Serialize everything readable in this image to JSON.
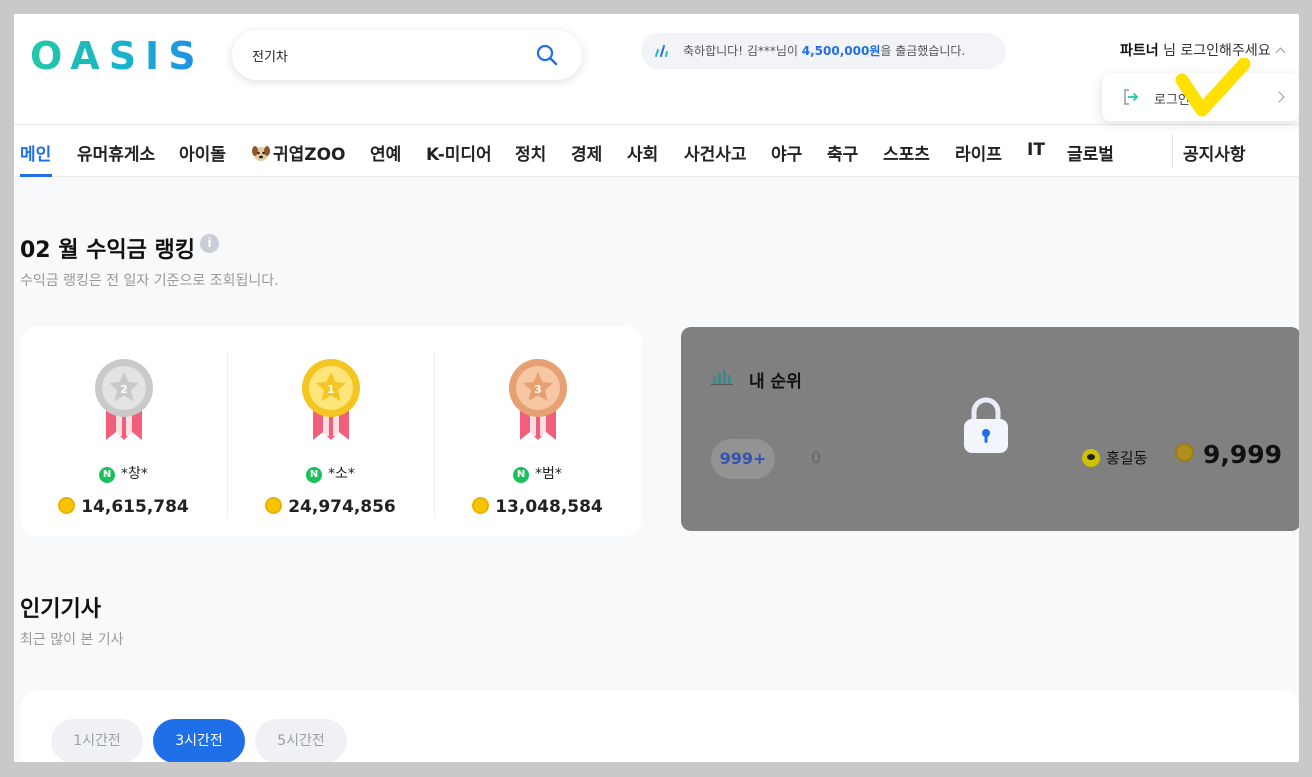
{
  "header": {
    "logo": "OASIS",
    "search_value": "전기차",
    "ticker": {
      "prefix": "축하합니다! 김***님이 ",
      "amount": "4,500,000원",
      "suffix": "을 출금했습니다."
    },
    "user": {
      "partner": "파트너",
      "text": " 님 로그인해주세요"
    },
    "dropdown": {
      "login_label": "로그인"
    }
  },
  "nav": {
    "items": [
      "메인",
      "유머휴게소",
      "아이돌",
      "귀엽ZOO",
      "연예",
      "K-미디어",
      "정치",
      "경제",
      "사회",
      "사건사고",
      "야구",
      "축구",
      "스포츠",
      "라이프",
      "IT",
      "글로벌"
    ],
    "notice": "공지사항",
    "active_index": 0
  },
  "ranking": {
    "title": "02 월 수익금 랭킹",
    "info_icon": "i",
    "subtitle": "수익금 랭킹은 전 일자 기준으로 조회됩니다.",
    "entries": [
      {
        "place": "2",
        "medal": "silver",
        "name": "*창*",
        "amount": "14,615,784"
      },
      {
        "place": "1",
        "medal": "gold",
        "name": "*소*",
        "amount": "24,974,856"
      },
      {
        "place": "3",
        "medal": "bronze",
        "name": "*범*",
        "amount": "13,048,584"
      }
    ],
    "naver_badge": "N"
  },
  "my_rank": {
    "title": "내 순위",
    "rank": "999+",
    "score": "0",
    "user_name": "홍길동",
    "amount": "9,999"
  },
  "popular": {
    "title": "인기기사",
    "subtitle": "최근 많이 본 기사",
    "tabs": [
      "1시간전",
      "3시간전",
      "5시간전"
    ],
    "active_tab": 1
  },
  "colors": {
    "accent": "#1f6fe8",
    "gold": "#f7c500",
    "naver": "#19c15a",
    "overlay": "#808080"
  }
}
